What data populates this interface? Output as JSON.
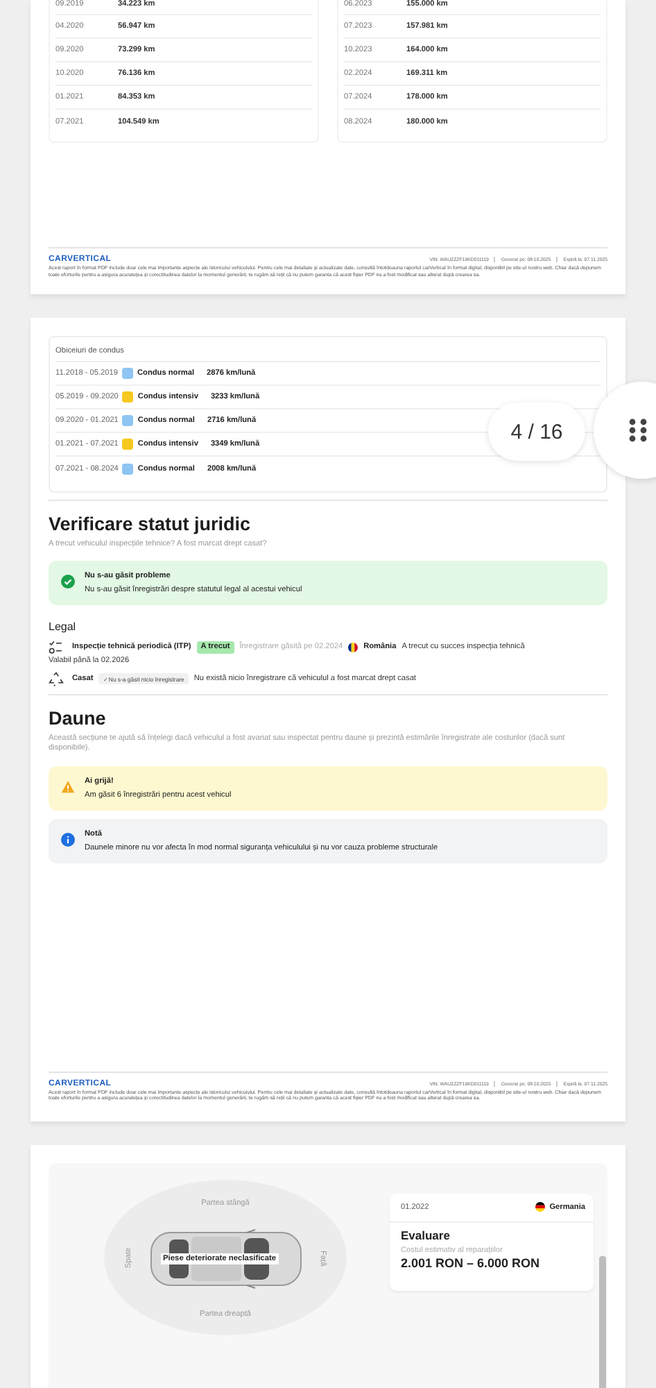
{
  "mileage": {
    "left": [
      {
        "date": "09.2019",
        "km": "34.223 km"
      },
      {
        "date": "04.2020",
        "km": "56.947 km"
      },
      {
        "date": "09.2020",
        "km": "73.299 km"
      },
      {
        "date": "10.2020",
        "km": "76.136 km"
      },
      {
        "date": "01.2021",
        "km": "84.353 km"
      },
      {
        "date": "07.2021",
        "km": "104.549 km"
      }
    ],
    "right": [
      {
        "date": "06.2023",
        "km": "155.000 km"
      },
      {
        "date": "07.2023",
        "km": "157.981 km"
      },
      {
        "date": "10.2023",
        "km": "164.000 km"
      },
      {
        "date": "02.2024",
        "km": "169.311 km"
      },
      {
        "date": "07.2024",
        "km": "178.000 km"
      },
      {
        "date": "08.2024",
        "km": "180.000 km"
      }
    ]
  },
  "footers": [
    {
      "logo": "CARVERTICAL",
      "vin": "VIN: WAUZZZF19KD011119",
      "generated": "Generat pe: 08.10.2025",
      "expires": "Expiră la: 07.11.2025",
      "disclaimer": "Acest raport în format PDF include doar cele mai importante aspecte ale istoricului vehiculului. Pentru cele mai detaliate și actualizate date, consultă întotdeauna raportul carVertical în format digital, disponibil pe site-ul nostru web. Chiar dacă depunem toate eforturile pentru a asigura acuratețea și corectitudinea datelor la momentul generării, te rugăm să reții că nu putem garanta că acest fișier PDF nu a fost modificat sau alterat după crearea sa."
    },
    {
      "logo": "CARVERTICAL",
      "vin": "VIN: WAUZZZF19KD011119",
      "generated": "Generat pe: 08.10.2025",
      "expires": "Expiră la: 07.11.2025",
      "disclaimer": "Acest raport în format PDF include doar cele mai importante aspecte ale istoricului vehiculului. Pentru cele mai detaliate și actualizate date, consultă întotdeauna raportul carVertical în format digital, disponibil pe site-ul nostru web. Chiar dacă depunem toate eforturile pentru a asigura acuratețea și corectitudinea datelor la momentul generării, te rugăm să reții că nu putem garanta că acest fișier PDF nu a fost modificat sau alterat după crearea sa."
    }
  ],
  "driving_habits": {
    "title": "Obiceiuri de condus",
    "rows": [
      {
        "period": "11.2018 - 05.2019",
        "color": "#8ec5f2",
        "label": "Condus normal",
        "value": "2876 km/lună"
      },
      {
        "period": "05.2019 - 09.2020",
        "color": "#f7c81e",
        "label": "Condus intensiv",
        "value": "3233 km/lună"
      },
      {
        "period": "09.2020 - 01.2021",
        "color": "#8ec5f2",
        "label": "Condus normal",
        "value": "2716 km/lună"
      },
      {
        "period": "01.2021 - 07.2021",
        "color": "#f7c81e",
        "label": "Condus intensiv",
        "value": "3349 km/lună"
      },
      {
        "period": "07.2021 - 08.2024",
        "color": "#8ec5f2",
        "label": "Condus normal",
        "value": "2008 km/lună"
      }
    ]
  },
  "pager": {
    "label": "4 / 16"
  },
  "legal": {
    "title": "Verificare statut juridic",
    "subtitle": "A trecut vehiculul inspecțiile tehnice? A fost marcat drept casat?",
    "status": {
      "title": "Nu s-au găsit probleme",
      "text": "Nu s-au găsit înregistrări despre statutul legal al acestui vehicul"
    },
    "heading": "Legal",
    "items": [
      {
        "kind": "inspection",
        "name": "Inspecție tehnică periodică (ITP)",
        "badge": "A trecut",
        "found": "Înregistrare găsită pe 02.2024",
        "country": "România",
        "note": "A trecut cu succes inspecția tehnică",
        "validity": "Valabil până la 02.2026"
      },
      {
        "kind": "scrapped",
        "name": "Casat",
        "badge": "✓ Nu s-a găsit nicio înregistrare",
        "note": "Nu există nicio înregistrare că vehiculul a fost marcat drept casat"
      }
    ]
  },
  "damage": {
    "title": "Daune",
    "description": "Această secțiune te ajută să înțelegi dacă vehiculul a fost avariat sau inspectat pentru daune și prezintă estimările înregistrate ale costurilor (dacă sunt disponibile).",
    "alerts": [
      {
        "kind": "warning",
        "title": "Ai grijă!",
        "text": "Am găsit 6 înregistrări pentru acest vehicul"
      },
      {
        "kind": "info",
        "title": "Notă",
        "text": "Daunele minore nu vor afecta în mod normal siguranța vehiculului și nu vor cauza probleme structurale"
      }
    ]
  },
  "damage_detail": {
    "diagram": {
      "top": "Partea stângă",
      "bottom": "Partea dreaptă",
      "rear": "Spate",
      "front": "Față",
      "label": "Piese deteriorate neclasificate"
    },
    "record": {
      "date": "01.2022",
      "country": "Germania",
      "title": "Evaluare",
      "cost_label": "Costul estimativ al reparațiilor",
      "cost": "2.001 RON – 6.000 RON"
    }
  }
}
